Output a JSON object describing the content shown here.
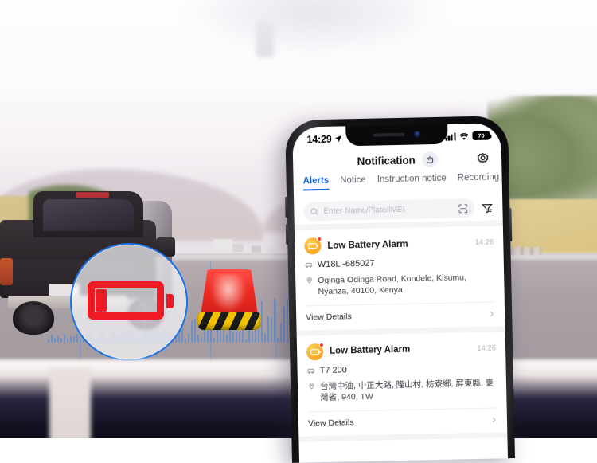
{
  "scene": {
    "description": "highway-dashcam-view-with-pickup-truck",
    "magnifier_icon": "low-battery-icon",
    "beacon_icon": "warning-beacon-light",
    "waveform_icon": "audio-waveform"
  },
  "phone": {
    "status_bar": {
      "time": "14:29",
      "location_icon": "location-arrow-icon",
      "signal_icon": "cellular-signal-icon",
      "wifi_icon": "wifi-icon",
      "battery_level": "70",
      "battery_icon": "battery-icon"
    },
    "header": {
      "title": "Notification",
      "robot_icon": "robot-icon",
      "settings_icon": "gear-icon"
    },
    "tabs": [
      {
        "label": "Alerts",
        "active": true
      },
      {
        "label": "Notice",
        "active": false
      },
      {
        "label": "Instruction notice",
        "active": false
      },
      {
        "label": "Recording",
        "active": false
      }
    ],
    "search": {
      "placeholder": "Enter Name/Plate/IMEI",
      "value": "",
      "search_icon": "search-icon",
      "scan_icon": "scan-qr-icon",
      "filter_icon": "filter-icon"
    },
    "alerts": [
      {
        "icon": "low-battery-alert-icon",
        "badge": "unread-dot",
        "title": "Low Battery Alarm",
        "time": "14:26",
        "vehicle_icon": "vehicle-icon",
        "vehicle": "W18L -685027",
        "location_icon": "map-pin-icon",
        "address": "Oginga Odinga Road, Kondele, Kisumu, Nyanza, 40100, Kenya",
        "action_label": "View Details",
        "chevron": "chevron-right-icon"
      },
      {
        "icon": "low-battery-alert-icon",
        "badge": "unread-dot",
        "title": "Low Battery Alarm",
        "time": "14:26",
        "vehicle_icon": "vehicle-icon",
        "vehicle": "T7 200",
        "location_icon": "map-pin-icon",
        "address": "台灣中油, 中正大路, 隆山村, 枋寮鄉, 屏東縣, 臺灣省, 940, TW",
        "action_label": "View Details",
        "chevron": "chevron-right-icon"
      }
    ]
  },
  "colors": {
    "accent_blue": "#1565ef",
    "alert_orange": "#f5a623",
    "badge_red": "#ff3b30",
    "magnifier_ring": "#1a73e8",
    "battery_red": "#ef1b24"
  }
}
